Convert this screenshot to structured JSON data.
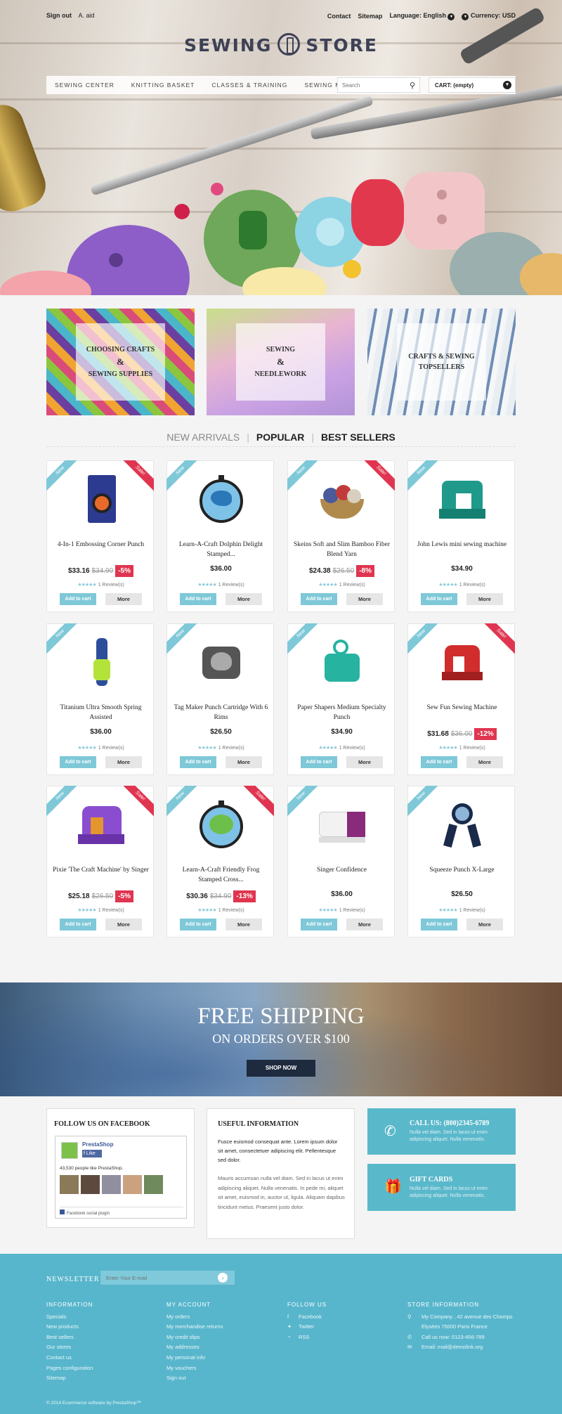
{
  "topbar": {
    "signout": "Sign out",
    "user": "A. aid",
    "contact": "Contact",
    "sitemap": "Sitemap",
    "language": "Language: English",
    "currency": "Currency: USD"
  },
  "logo": {
    "left": "SEWING",
    "right": "STORE"
  },
  "menu": [
    "SEWING CENTER",
    "KNITTING BASKET",
    "CLASSES & TRAINING",
    "SEWING MACHINES"
  ],
  "search": {
    "placeholder": "Search"
  },
  "cart": {
    "label": "CART: (empty)"
  },
  "banners": [
    {
      "l1": "CHOOSING CRAFTS",
      "amp": "&",
      "l2": "SEWING SUPPLIES"
    },
    {
      "l1": "SEWING",
      "amp": "&",
      "l2": "NEEDLEWORK"
    },
    {
      "l1": "CRAFTS & SEWING",
      "amp": "",
      "l2": "TOPSELLERS"
    }
  ],
  "tabs": [
    "NEW ARRIVALS",
    "POPULAR",
    "BEST SELLERS"
  ],
  "product_common": {
    "new": "New",
    "sale": "Sale!",
    "add_to_cart": "Add to cart",
    "more": "More",
    "reviews": "1 Review(s)",
    "stars": "★★★★★"
  },
  "products": [
    {
      "name": "4-In-1 Embossing Corner Punch",
      "price": "$33.16",
      "old": "$34.90",
      "disc": "-5%"
    },
    {
      "name": "Learn-A-Craft Dolphin Delight Stamped...",
      "price": "$36.00",
      "old": "",
      "disc": ""
    },
    {
      "name": "Skeins Soft and Slim Bamboo Fiber Blend Yarn",
      "price": "$24.38",
      "old": "$26.50",
      "disc": "-8%"
    },
    {
      "name": "John Lewis mini sewing machine",
      "price": "$34.90",
      "old": "",
      "disc": ""
    },
    {
      "name": "Titanium Ultra Smooth Spring Assisted",
      "price": "$36.00",
      "old": "",
      "disc": ""
    },
    {
      "name": "Tag Maker Punch Cartridge With 6 Rims",
      "price": "$26.50",
      "old": "",
      "disc": ""
    },
    {
      "name": "Paper Shapers Medium Specialty Punch",
      "price": "$34.90",
      "old": "",
      "disc": ""
    },
    {
      "name": "Sew Fun Sewing Machine",
      "price": "$31.68",
      "old": "$36.00",
      "disc": "-12%"
    },
    {
      "name": "Pixie 'The Craft Machine' by Singer",
      "price": "$25.18",
      "old": "$26.50",
      "disc": "-5%"
    },
    {
      "name": "Learn-A-Craft Friendly Frog Stamped Cross...",
      "price": "$30.36",
      "old": "$34.90",
      "disc": "-13%"
    },
    {
      "name": "Singer Confidence",
      "price": "$36.00",
      "old": "",
      "disc": ""
    },
    {
      "name": "Squeeze Punch X-Large",
      "price": "$26.50",
      "old": "",
      "disc": ""
    }
  ],
  "shipping": {
    "title": "FREE SHIPPING",
    "subtitle": "ON ORDERS OVER $100",
    "button": "SHOP NOW"
  },
  "facebook": {
    "title": "FOLLOW US ON FACEBOOK",
    "page": "PrestaShop",
    "like": "Like",
    "count": "43,530 people like PrestaShop.",
    "plugin": "Facebook social plugin"
  },
  "useful": {
    "title": "USEFUL INFORMATION",
    "p1": "Fusce euismod consequat ante. Lorem ipsum dolor sit amet, consectetuer adipiscing elit. Pellentesque sed dolor.",
    "p2": "Mauris accumsan nulla vel diam. Sed in lacus ut enim adipiscing aliquet. Nulla venenatis. In pede mi, aliquet sit amet, euismod in, auctor ut, ligula. Aliquam dapibus tincidunt metus. Praesent justo dolor."
  },
  "callus": {
    "title": "CALL US: (800)2345-6789",
    "desc": "Nulla vel diam. Sed in lacus ut enim adipiscing aliquet. Nulla venenatis."
  },
  "gift": {
    "title": "GIFT CARDS",
    "desc": "Nulla vel diam. Sed in lacus ut enim adipiscing aliquet. Nulla venenatis."
  },
  "newsletter": {
    "label": "NEWSLETTER",
    "placeholder": "Enter Your E-mail"
  },
  "footer": {
    "information": {
      "title": "INFORMATION",
      "items": [
        "Specials",
        "New products",
        "Best sellers",
        "Our stores",
        "Contact us",
        "Pages configuration",
        "Sitemap"
      ]
    },
    "account": {
      "title": "MY ACCOUNT",
      "items": [
        "My orders",
        "My merchandise returns",
        "My credit slips",
        "My addresses",
        "My personal info",
        "My vouchers",
        "Sign out"
      ]
    },
    "follow": {
      "title": "FOLLOW US",
      "items": [
        "Facebook",
        "Twitter",
        "RSS"
      ]
    },
    "store": {
      "title": "STORE INFORMATION",
      "address1": "My Company , 42 avenue des Champs",
      "address2": "Elysées 75000 Paris France",
      "call": "Call us now: 0123-456-789",
      "email": "Email: mail@demolink.org"
    },
    "copyright": "© 2014 Ecommerce software by PrestaShop™"
  }
}
